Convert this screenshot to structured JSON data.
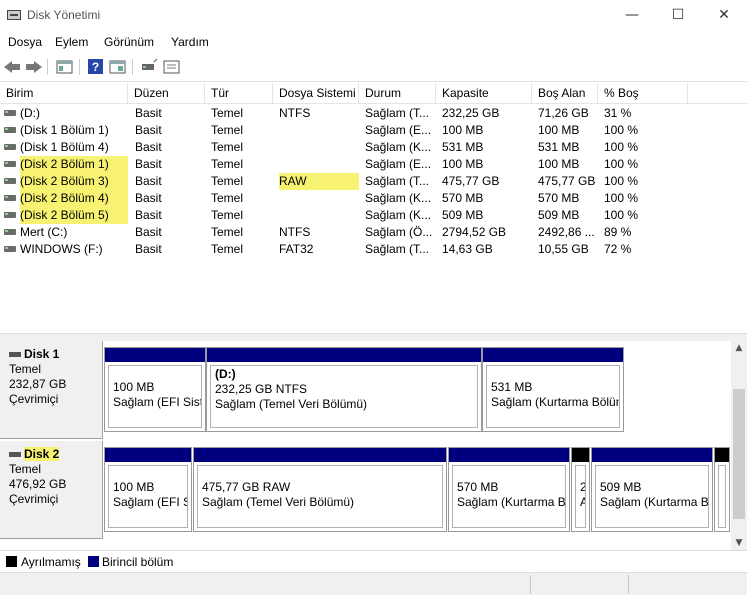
{
  "window": {
    "title": "Disk Yönetimi",
    "minimize": "—",
    "maximize": "☐",
    "close": "✕"
  },
  "menu": [
    "Dosya",
    "Eylem",
    "Görünüm",
    "Yardım"
  ],
  "columns": [
    "Birim",
    "Düzen",
    "Tür",
    "Dosya Sistemi",
    "Durum",
    "Kapasite",
    "Boş Alan",
    "% Boş"
  ],
  "volumes": [
    {
      "name": "(D:)",
      "layout": "Basit",
      "type": "Temel",
      "fs": "NTFS",
      "status": "Sağlam (T...",
      "capacity": "232,25 GB",
      "free": "71,26 GB",
      "pct": "31 %",
      "highlight": false
    },
    {
      "name": "(Disk 1 Bölüm 1)",
      "layout": "Basit",
      "type": "Temel",
      "fs": "",
      "status": "Sağlam (E...",
      "capacity": "100 MB",
      "free": "100 MB",
      "pct": "100 %",
      "highlight": false
    },
    {
      "name": "(Disk 1 Bölüm 4)",
      "layout": "Basit",
      "type": "Temel",
      "fs": "",
      "status": "Sağlam (K...",
      "capacity": "531 MB",
      "free": "531 MB",
      "pct": "100 %",
      "highlight": false
    },
    {
      "name": "(Disk 2 Bölüm 1)",
      "layout": "Basit",
      "type": "Temel",
      "fs": "",
      "status": "Sağlam (E...",
      "capacity": "100 MB",
      "free": "100 MB",
      "pct": "100 %",
      "highlight": true
    },
    {
      "name": "(Disk 2 Bölüm 3)",
      "layout": "Basit",
      "type": "Temel",
      "fs": "RAW",
      "status": "Sağlam (T...",
      "capacity": "475,77 GB",
      "free": "475,77 GB",
      "pct": "100 %",
      "highlight": true
    },
    {
      "name": "(Disk 2 Bölüm 4)",
      "layout": "Basit",
      "type": "Temel",
      "fs": "",
      "status": "Sağlam (K...",
      "capacity": "570 MB",
      "free": "570 MB",
      "pct": "100 %",
      "highlight": true
    },
    {
      "name": "(Disk 2 Bölüm 5)",
      "layout": "Basit",
      "type": "Temel",
      "fs": "",
      "status": "Sağlam (K...",
      "capacity": "509 MB",
      "free": "509 MB",
      "pct": "100 %",
      "highlight": true
    },
    {
      "name": "Mert (C:)",
      "layout": "Basit",
      "type": "Temel",
      "fs": "NTFS",
      "status": "Sağlam (Ö...",
      "capacity": "2794,52 GB",
      "free": "2492,86 ...",
      "pct": "89 %",
      "highlight": false
    },
    {
      "name": "WINDOWS (F:)",
      "layout": "Basit",
      "type": "Temel",
      "fs": "FAT32",
      "status": "Sağlam (T...",
      "capacity": "14,63 GB",
      "free": "10,55 GB",
      "pct": "72 %",
      "highlight": false
    }
  ],
  "disks": [
    {
      "name": "Disk 1",
      "type": "Temel",
      "size": "232,87 GB",
      "state": "Çevrimiçi",
      "highlight": false,
      "partitions": [
        {
          "title": "",
          "line1": "100 MB",
          "line2": "Sağlam (EFI Sistem Bölümü)",
          "bar": "primary"
        },
        {
          "title": "(D:)",
          "line1": "232,25 GB NTFS",
          "line2": "Sağlam (Temel Veri Bölümü)",
          "bar": "primary"
        },
        {
          "title": "",
          "line1": "531 MB",
          "line2": "Sağlam (Kurtarma Bölümü)",
          "bar": "primary"
        }
      ]
    },
    {
      "name": "Disk 2",
      "type": "Temel",
      "size": "476,92 GB",
      "state": "Çevrimiçi",
      "highlight": true,
      "partitions": [
        {
          "title": "",
          "line1": "100 MB",
          "line2": "Sağlam (EFI Sistem Bölümü)",
          "bar": "primary"
        },
        {
          "title": "",
          "line1": "475,77 GB RAW",
          "line2": "Sağlam (Temel Veri Bölümü)",
          "bar": "primary"
        },
        {
          "title": "",
          "line1": "570 MB",
          "line2": "Sağlam (Kurtarma Bölümü)",
          "bar": "primary"
        },
        {
          "title": "",
          "line1": "2",
          "line2": "A",
          "bar": "unallocated"
        },
        {
          "title": "",
          "line1": "509 MB",
          "line2": "Sağlam (Kurtarma Bölümü)",
          "bar": "primary"
        },
        {
          "title": "",
          "line1": "",
          "line2": "",
          "bar": "unallocated"
        }
      ]
    }
  ],
  "legend": [
    {
      "label": "Ayrılmamış",
      "color": "#000000"
    },
    {
      "label": "Birincil bölüm",
      "color": "#00007f"
    }
  ],
  "colors": {
    "primary": "#00007f",
    "unallocated": "#000000",
    "highlight": "#f7f272"
  }
}
